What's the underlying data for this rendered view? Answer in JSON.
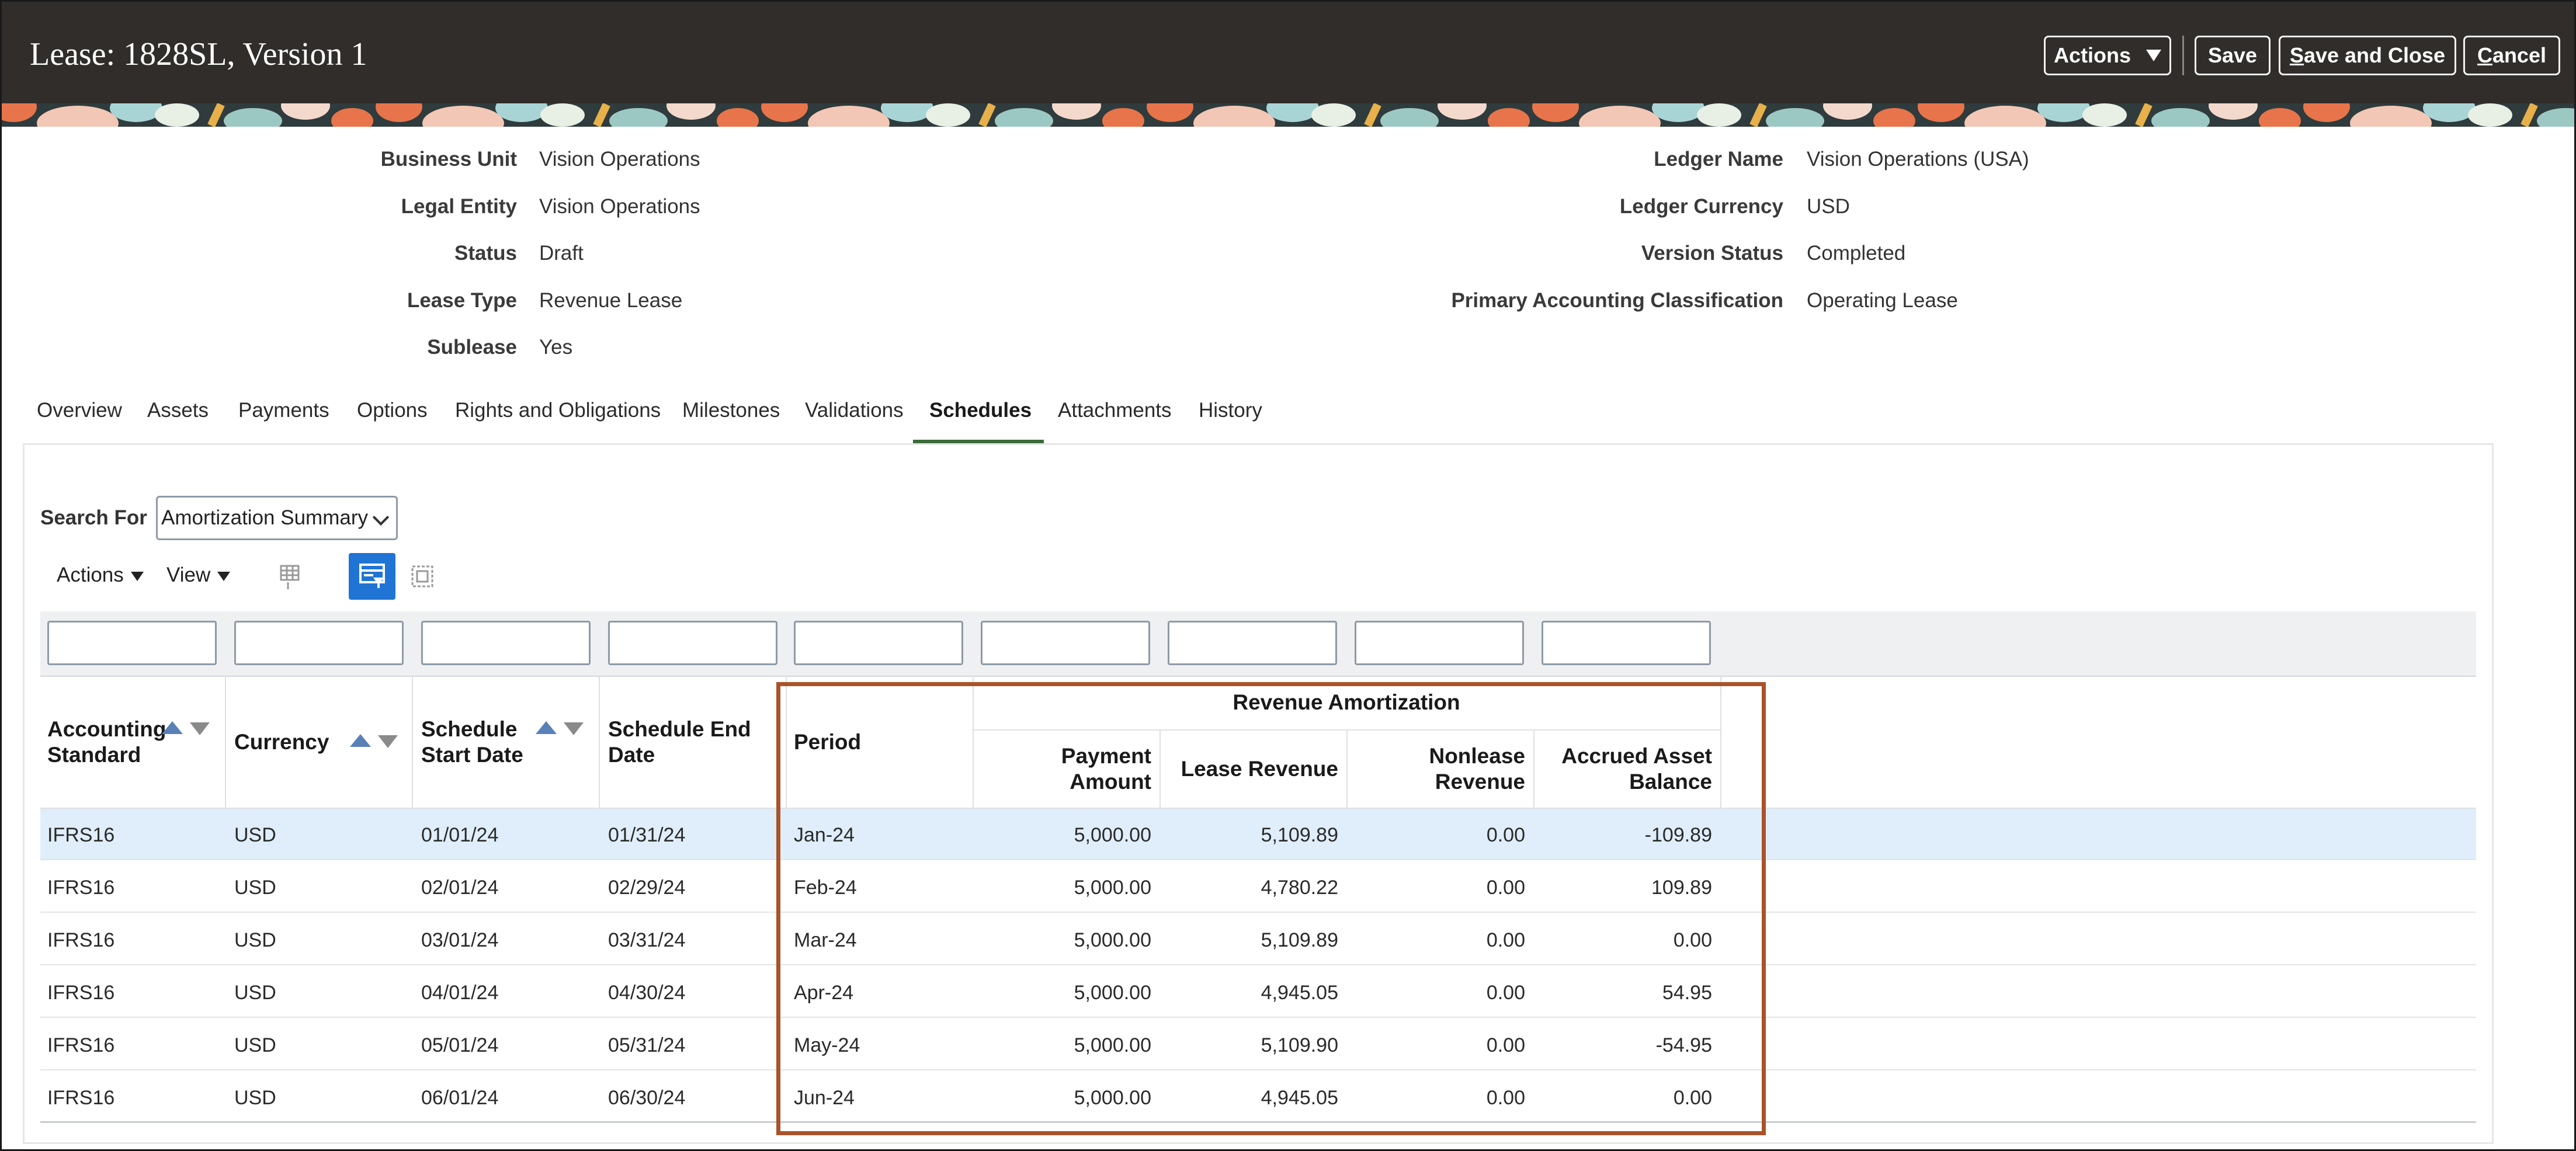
{
  "header": {
    "title": "Lease: 1828SL, Version 1",
    "actions_label": "Actions",
    "save_label": "Save",
    "save_close_prefix": "S",
    "save_close_rest": "ave and Close",
    "cancel_prefix": "C",
    "cancel_rest": "ancel"
  },
  "info": {
    "business_unit_label": "Business Unit",
    "business_unit": "Vision Operations",
    "legal_entity_label": "Legal Entity",
    "legal_entity": "Vision Operations",
    "status_label": "Status",
    "status": "Draft",
    "lease_type_label": "Lease Type",
    "lease_type": "Revenue Lease",
    "sublease_label": "Sublease",
    "sublease": "Yes",
    "ledger_name_label": "Ledger Name",
    "ledger_name": "Vision Operations (USA)",
    "ledger_currency_label": "Ledger Currency",
    "ledger_currency": "USD",
    "version_status_label": "Version Status",
    "version_status": "Completed",
    "pac_label": "Primary Accounting Classification",
    "pac": "Operating Lease"
  },
  "tabs": [
    "Overview",
    "Assets",
    "Payments",
    "Options",
    "Rights and Obligations",
    "Milestones",
    "Validations",
    "Schedules",
    "Attachments",
    "History"
  ],
  "active_tab": "Schedules",
  "toolbar": {
    "search_for_label": "Search For",
    "search_for_value": "Amortization Summary",
    "actions_label": "Actions",
    "view_label": "View"
  },
  "table": {
    "headers": {
      "accounting_standard": [
        "Accounting",
        "Standard"
      ],
      "currency": "Currency",
      "schedule_start_date": [
        "Schedule",
        "Start Date"
      ],
      "schedule_end_date": [
        "Schedule End",
        "Date"
      ],
      "period": "Period",
      "group": "Revenue Amortization",
      "payment_amount": [
        "Payment",
        "Amount"
      ],
      "lease_revenue": "Lease Revenue",
      "nonlease_revenue": [
        "Nonlease",
        "Revenue"
      ],
      "accrued_asset_balance": [
        "Accrued Asset",
        "Balance"
      ]
    },
    "rows": [
      [
        "IFRS16",
        "USD",
        "01/01/24",
        "01/31/24",
        "Jan-24",
        "5,000.00",
        "5,109.89",
        "0.00",
        "-109.89"
      ],
      [
        "IFRS16",
        "USD",
        "02/01/24",
        "02/29/24",
        "Feb-24",
        "5,000.00",
        "4,780.22",
        "0.00",
        "109.89"
      ],
      [
        "IFRS16",
        "USD",
        "03/01/24",
        "03/31/24",
        "Mar-24",
        "5,000.00",
        "5,109.89",
        "0.00",
        "0.00"
      ],
      [
        "IFRS16",
        "USD",
        "04/01/24",
        "04/30/24",
        "Apr-24",
        "5,000.00",
        "4,945.05",
        "0.00",
        "54.95"
      ],
      [
        "IFRS16",
        "USD",
        "05/01/24",
        "05/31/24",
        "May-24",
        "5,000.00",
        "5,109.90",
        "0.00",
        "-54.95"
      ],
      [
        "IFRS16",
        "USD",
        "06/01/24",
        "06/30/24",
        "Jun-24",
        "5,000.00",
        "4,945.05",
        "0.00",
        "0.00"
      ]
    ]
  },
  "colors": {
    "header_bg": "#302d2a",
    "active_tab_underline": "#3a6b39",
    "selected_row": "#dfeefa",
    "highlight_box": "#a9532b",
    "query_button": "#1f74d4"
  },
  "icons": [
    "caret-down-icon",
    "freeze-columns-icon",
    "query-by-example-icon",
    "detach-icon",
    "sort-ascending-icon",
    "sort-descending-icon"
  ]
}
